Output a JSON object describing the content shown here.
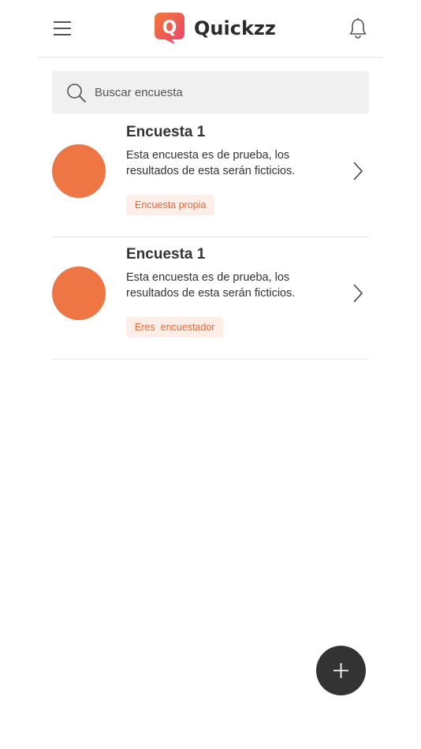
{
  "app": {
    "name": "Quickzz",
    "logo_letter": "Q",
    "brand_color": "#ee4b6a"
  },
  "header": {
    "menu_icon": "menu-icon",
    "notification_icon": "bell-icon"
  },
  "search": {
    "placeholder": "Buscar encuesta",
    "value": ""
  },
  "surveys": [
    {
      "title": "Encuesta 1",
      "description": "Esta encuesta es de prueba, los resultados de esta serán ficticios.",
      "badge": "Encuesta propia",
      "avatar_color": "#ee7544"
    },
    {
      "title": "Encuesta 1",
      "description": "Esta encuesta es de prueba, los resultados de esta serán ficticios.",
      "badge": "Eres  encuestador",
      "avatar_color": "#ee7544"
    }
  ],
  "fab": {
    "icon": "plus-icon",
    "color": "#333333"
  }
}
